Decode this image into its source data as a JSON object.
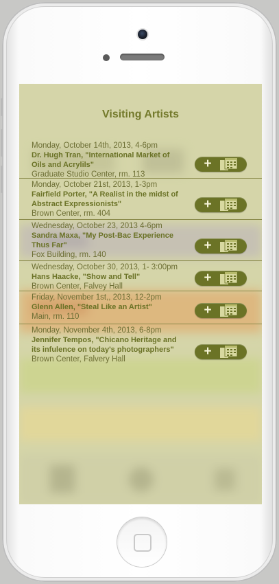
{
  "screen": {
    "title": "Visiting Artists",
    "events": [
      {
        "date": "Monday, October 14th, 2013, 4-6pm",
        "name": "Dr. Hugh Tran, \"International Market of Oils and Acrylils\"",
        "place": "Graduate Studio Center, rm. 113"
      },
      {
        "date": "Monday, October 21st, 2013, 1-3pm",
        "name": "Fairfield Porter, \"A Realist in the midst of Abstract Expressionists\"",
        "place": "Brown Center, rm. 404"
      },
      {
        "date": "Wednesday, October 23, 2013 4-6pm",
        "name": "Sandra Maxa, \"My Post-Bac Experience Thus Far\"",
        "place": "Fox Building, rm. 140"
      },
      {
        "date": "Wednesday, October 30, 2013, 1- 3:00pm",
        "name": "Hans Haacke, \"Show and Tell\"",
        "place": "Brown Center, Falvey Hall"
      },
      {
        "date": "Friday, November 1st,, 2013, 12-2pm",
        "name": "Glenn Allen, \"Steal Like an Artist\"",
        "place": "Main, rm. 110"
      },
      {
        "date": "Monday, November 4th, 2013, 6-8pm",
        "name": "Jennifer Tempos, \"Chicano Heritage and its infulence on today's photographers\"",
        "place": "Brown Center, Falvery Hall"
      }
    ]
  },
  "buttons": {
    "add_symbol": "+",
    "calendar_icon": "calendar-icon"
  },
  "colors": {
    "title": "#747a2c",
    "button_bg": "#6b7326",
    "overlay": "#d6d596"
  }
}
